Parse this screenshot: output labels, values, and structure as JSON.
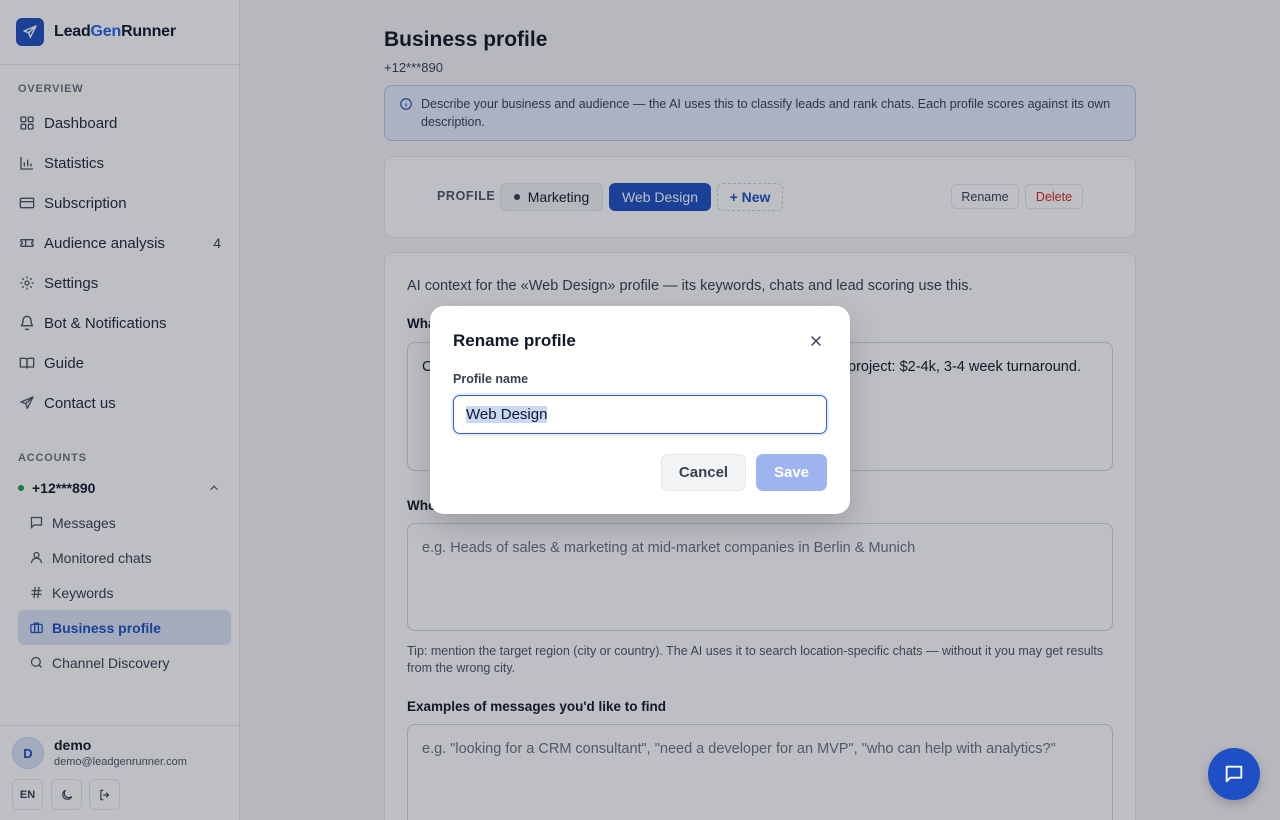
{
  "brand": {
    "prefix": "Lead",
    "gen": "Gen",
    "suffix": "Runner"
  },
  "sidebar": {
    "overview_label": "OVERVIEW",
    "nav": [
      {
        "label": "Dashboard",
        "icon": "dashboard-icon"
      },
      {
        "label": "Statistics",
        "icon": "bar-chart-icon"
      },
      {
        "label": "Subscription",
        "icon": "credit-card-icon"
      },
      {
        "label": "Audience analysis",
        "icon": "ticket-icon",
        "badge": "4"
      },
      {
        "label": "Settings",
        "icon": "gear-icon"
      },
      {
        "label": "Bot & Notifications",
        "icon": "bell-icon"
      },
      {
        "label": "Guide",
        "icon": "book-icon"
      },
      {
        "label": "Contact us",
        "icon": "send-icon"
      }
    ],
    "accounts_label": "ACCOUNTS",
    "account": {
      "phone": "+12***890"
    },
    "sub_items": [
      {
        "label": "Messages",
        "icon": "message-icon"
      },
      {
        "label": "Monitored chats",
        "icon": "user-icon"
      },
      {
        "label": "Keywords",
        "icon": "hash-icon"
      },
      {
        "label": "Business profile",
        "icon": "briefcase-icon"
      },
      {
        "label": "Channel Discovery",
        "icon": "search-icon"
      }
    ],
    "user": {
      "initial": "D",
      "name": "demo",
      "email": "demo@leadgenrunner.com"
    },
    "lang": "EN"
  },
  "main": {
    "title": "Business profile",
    "subtitle": "+12***890",
    "info": "Describe your business and audience — the AI uses this to classify leads and rank chats. Each profile scores against its own description.",
    "profile_label": "PROFILE",
    "profiles": [
      "Marketing",
      "Web Design"
    ],
    "new_label": "+ New",
    "rename_label": "Rename",
    "delete_label": "Delete",
    "context_text": "AI context for the «Web Design» profile — its keywords, chats and lead scoring use this.",
    "field1_label_partial": "Wha",
    "field1_value_left": "C",
    "field1_value_right": "project: $2-4k, 3-4 week turnaround.",
    "field2_label_partial": "Who",
    "field2_placeholder": "e.g. Heads of sales & marketing at mid-market companies in Berlin & Munich",
    "tip": "Tip: mention the target region (city or country). The AI uses it to search location-specific chats — without it you may get results from the wrong city.",
    "field3_label": "Examples of messages you'd like to find",
    "field3_placeholder": "e.g. \"looking for a CRM consultant\", \"need a developer for an MVP\", \"who can help with analytics?\""
  },
  "modal": {
    "title": "Rename profile",
    "label": "Profile name",
    "value": "Web Design",
    "cancel": "Cancel",
    "save": "Save"
  },
  "colors": {
    "accent": "#1e4fc4",
    "danger": "#dc2626",
    "online": "#16a34a"
  }
}
